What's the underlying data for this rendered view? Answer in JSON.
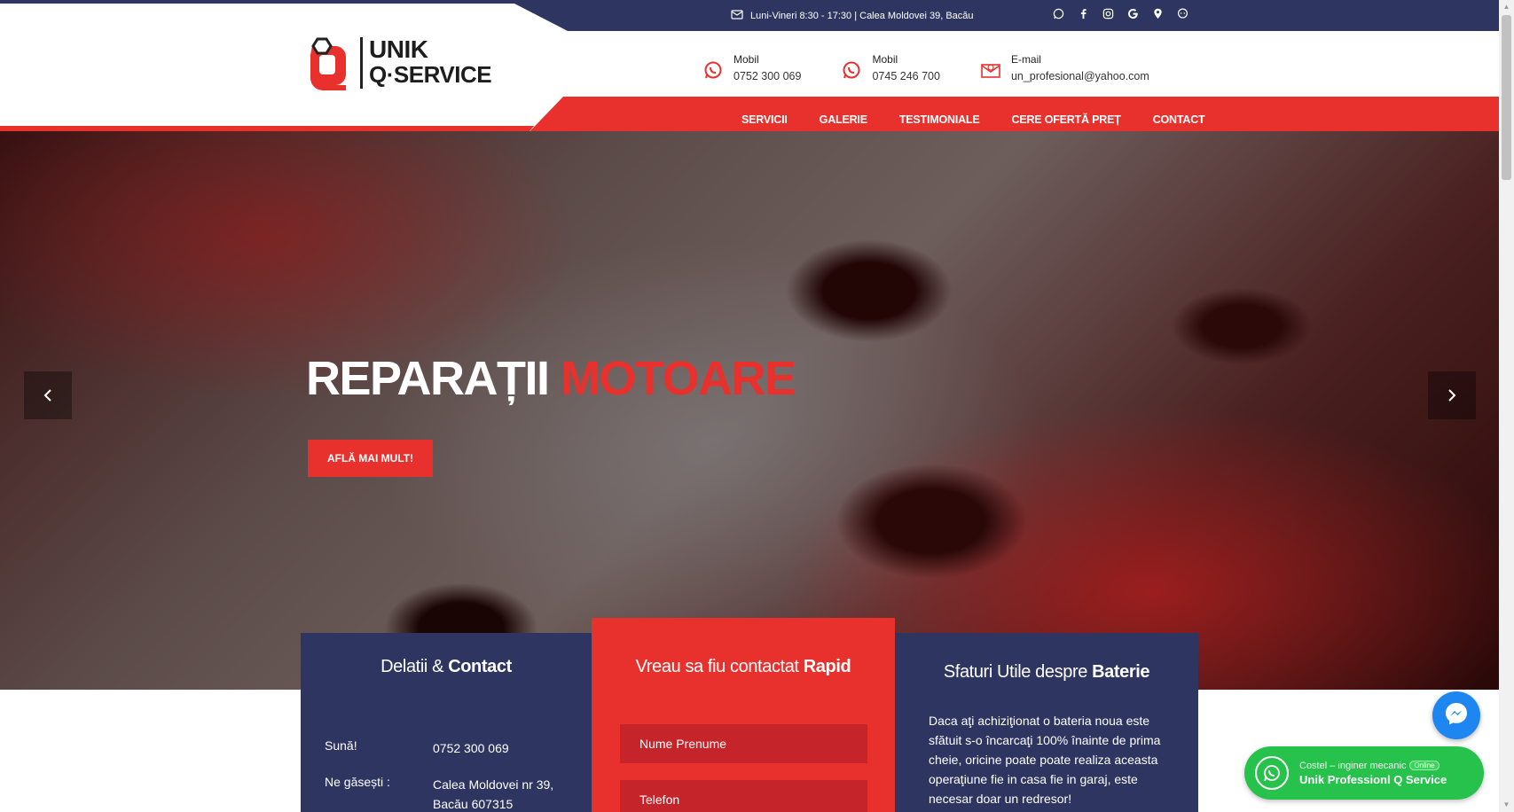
{
  "topbar": {
    "info": "Luni-Vineri 8:30 - 17:30 | Calea Moldovei 39, Bacău",
    "icons": [
      "whatsapp-icon",
      "facebook-icon",
      "instagram-icon",
      "google-icon",
      "map-pin-icon",
      "chat-icon"
    ]
  },
  "logo": {
    "line1": "UNIK",
    "line2": "Q·SERVICE"
  },
  "contacts": [
    {
      "label": "Mobil",
      "value": "0752 300 069",
      "icon": "whatsapp-icon"
    },
    {
      "label": "Mobil",
      "value": "0745 246 700",
      "icon": "whatsapp-icon"
    },
    {
      "label": "E-mail",
      "value": "un_profesional@yahoo.com",
      "icon": "envelope-icon"
    }
  ],
  "nav": {
    "items": [
      "SERVICII",
      "GALERIE",
      "TESTIMONIALE",
      "CERE OFERTĂ PREȚ",
      "CONTACT"
    ],
    "active": "CERE OFERTĂ PREȚ"
  },
  "hero": {
    "title_white": "REPARAȚII",
    "title_red": "MOTOARE",
    "button": "AFLĂ MAI MULT!"
  },
  "panels": {
    "contact": {
      "title_light": "Delatii &",
      "title_bold": "Contact",
      "rows": [
        {
          "key": "Sună!",
          "value": "0752 300 069"
        },
        {
          "key": "Ne găsești :",
          "value": "Calea Moldovei nr 39, Bacău 607315"
        }
      ]
    },
    "quick": {
      "title_light": "Vreau sa fiu contactat",
      "title_bold": "Rapid",
      "name_placeholder": "Nume Prenume",
      "phone_placeholder": "Telefon"
    },
    "tips": {
      "title_light": "Sfaturi Utile despre",
      "title_bold": "Baterie",
      "text": "Daca aţi achiziţionat o bateria noua este sfătuit s-o încarcaţi 100% înainte de prima cheie, oricine poate poate realiza aceasta operaţiune fie in casa fie in garaj, este necesar doar un redresor!"
    }
  },
  "whatsapp_widget": {
    "small": "Costel – inginer mecanic",
    "badge": "Online",
    "big": "Unik Professionl Q Service"
  },
  "colors": {
    "navy": "#2e3561",
    "red": "#e8312d",
    "green": "#27c24c",
    "messenger": "#1e86f0"
  }
}
